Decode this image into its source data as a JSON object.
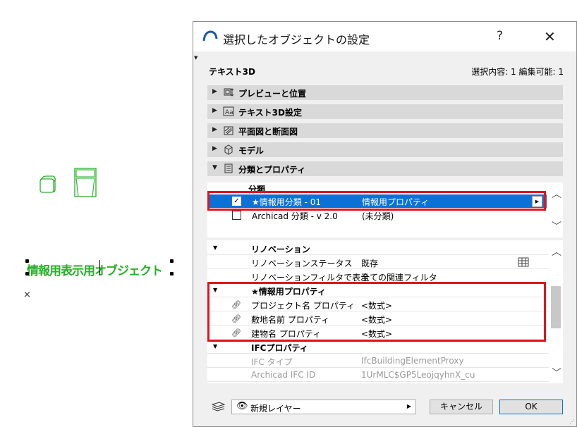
{
  "canvas": {
    "object_text_left": "情報用表示",
    "object_text_right": "用オブジェクト",
    "marker": "×"
  },
  "dialog": {
    "title": "選択したオブジェクトの設定",
    "help": "?",
    "close": "✕",
    "element_type": "テキスト3D",
    "selection_info": "選択内容: 1 編集可能: 1",
    "sections": [
      {
        "label": "プレビューと位置",
        "icon": "preview-position-icon"
      },
      {
        "label": "テキスト3D設定",
        "icon": "text3d-settings-icon"
      },
      {
        "label": "平面図と断面図",
        "icon": "floorplan-section-icon"
      },
      {
        "label": "モデル",
        "icon": "model-cube-icon"
      },
      {
        "label": "分類とプロパティ",
        "icon": "classification-icon"
      }
    ],
    "classification": {
      "header": "分類",
      "rows": [
        {
          "checked": true,
          "system": "★情報用分類 - 01",
          "value": "情報用プロパティ",
          "selected": true
        },
        {
          "checked": false,
          "system": "Archicad 分類 - v 2.0",
          "value": "(未分類)",
          "selected": false
        }
      ]
    },
    "properties": [
      {
        "type": "group",
        "name": "リノベーション"
      },
      {
        "type": "row",
        "name": "リノベーションステータス",
        "value": "既存"
      },
      {
        "type": "row",
        "name": "リノベーションフィルタで表示",
        "value": "全ての関連フィルタ"
      },
      {
        "type": "group",
        "name": "★情報用プロパティ"
      },
      {
        "type": "link",
        "name": "プロジェクト名 プロパティ",
        "value": "<数式>"
      },
      {
        "type": "link",
        "name": "敷地名前 プロパティ",
        "value": "<数式>"
      },
      {
        "type": "link",
        "name": "建物名 プロパティ",
        "value": "<数式>"
      },
      {
        "type": "group",
        "name": "IFCプロパティ"
      },
      {
        "type": "grey",
        "name": "IFC タイプ",
        "value": "IfcBuildingElementProxy"
      },
      {
        "type": "grey",
        "name": "Archicad IFC ID",
        "value": "1UrMLC$GP5LeojqyhnX_cu"
      }
    ],
    "layer": "新規レイヤー",
    "cancel_label": "キャンセル",
    "ok_label": "OK",
    "accent_color": "#0a72d6",
    "highlight_color": "#e0141e",
    "object_color": "#27b027"
  }
}
